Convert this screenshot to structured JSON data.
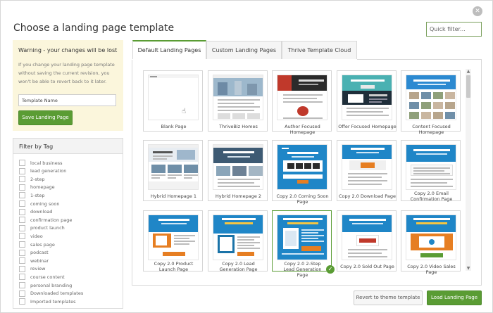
{
  "dialog": {
    "title": "Choose a landing page template",
    "close_glyph": "✕",
    "quick_filter_placeholder": "Quick filter..."
  },
  "warning": {
    "heading": "Warning - your changes will be lost",
    "message": "If you change your landing page template without saving the current revision, you won't be able to revert back to it later.",
    "template_name_placeholder": "Template Name",
    "save_label": "Save Landing Page"
  },
  "filter": {
    "heading": "Filter by Tag",
    "tags": [
      "local business",
      "lead generation",
      "2-step",
      "homepage",
      "1-step",
      "coming soon",
      "download",
      "confirmation page",
      "product launch",
      "video",
      "sales page",
      "podcast",
      "webinar",
      "review",
      "course content",
      "personal branding",
      "Downloaded templates",
      "Imported templates"
    ]
  },
  "tabs": [
    {
      "label": "Default Landing Pages",
      "active": true
    },
    {
      "label": "Custom Landing Pages",
      "active": false
    },
    {
      "label": "Thrive Template Cloud",
      "active": false
    }
  ],
  "templates": [
    {
      "label": "Blank Page"
    },
    {
      "label": "ThriveBiz Homes"
    },
    {
      "label": "Author Focused Homepage"
    },
    {
      "label": "Offer Focused Homepage"
    },
    {
      "label": "Content Focused Homepage"
    },
    {
      "label": "Hybrid Homepage 1"
    },
    {
      "label": "Hybrid Homepage 2"
    },
    {
      "label": "Copy 2.0 Coming Soon Page"
    },
    {
      "label": "Copy 2.0 Download Page"
    },
    {
      "label": "Copy 2.0 Email Confirmation Page"
    },
    {
      "label": "Copy 2.0 Product Launch Page"
    },
    {
      "label": "Copy 2.0 Lead Generation Page"
    },
    {
      "label": "Copy 2.0 2-Step Lead Generation Page",
      "selected": true
    },
    {
      "label": "Copy 2.0 Sold Out Page"
    },
    {
      "label": "Copy 2.0 Video Sales Page"
    }
  ],
  "footer": {
    "revert_label": "Revert to theme template",
    "load_label": "Load Landing Page"
  },
  "colors": {
    "accent_green": "#5a9c34",
    "warning_bg": "#fbf6dc",
    "thumb_blue": "#1f86c7"
  },
  "icons": {
    "close": "close-icon",
    "selected_check": "checkmark-icon",
    "cursor": "hand-cursor-icon"
  }
}
